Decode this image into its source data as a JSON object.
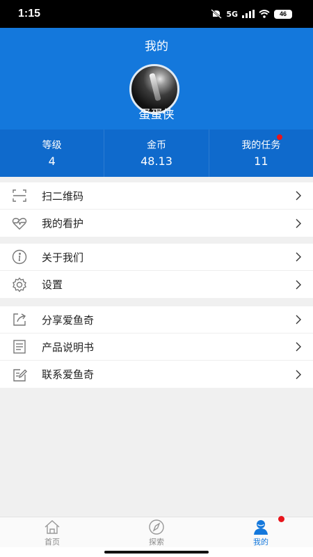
{
  "status_bar": {
    "time": "1:15",
    "network": "5G",
    "battery": "46"
  },
  "header": {
    "title": "我的",
    "username": "蛋蛋侠"
  },
  "stats": [
    {
      "label": "等级",
      "value": "4"
    },
    {
      "label": "金币",
      "value": "48.13"
    },
    {
      "label": "我的任务",
      "value": "11"
    }
  ],
  "menu_groups": [
    [
      {
        "label": "扫二维码",
        "icon": "scan-qr-icon"
      },
      {
        "label": "我的看护",
        "icon": "heart-pulse-icon"
      }
    ],
    [
      {
        "label": "关于我们",
        "icon": "info-icon"
      },
      {
        "label": "设置",
        "icon": "gear-icon"
      }
    ],
    [
      {
        "label": "分享爱鱼奇",
        "icon": "share-icon"
      },
      {
        "label": "产品说明书",
        "icon": "document-icon"
      },
      {
        "label": "联系爱鱼奇",
        "icon": "edit-contact-icon"
      }
    ]
  ],
  "tabbar": [
    {
      "label": "首页",
      "icon": "home-icon"
    },
    {
      "label": "探索",
      "icon": "compass-icon"
    },
    {
      "label": "我的",
      "icon": "user-icon",
      "active": true
    }
  ],
  "colors": {
    "header_blue": "#1478dc",
    "stats_blue": "#0f6acc",
    "badge_red": "#e8151c"
  }
}
